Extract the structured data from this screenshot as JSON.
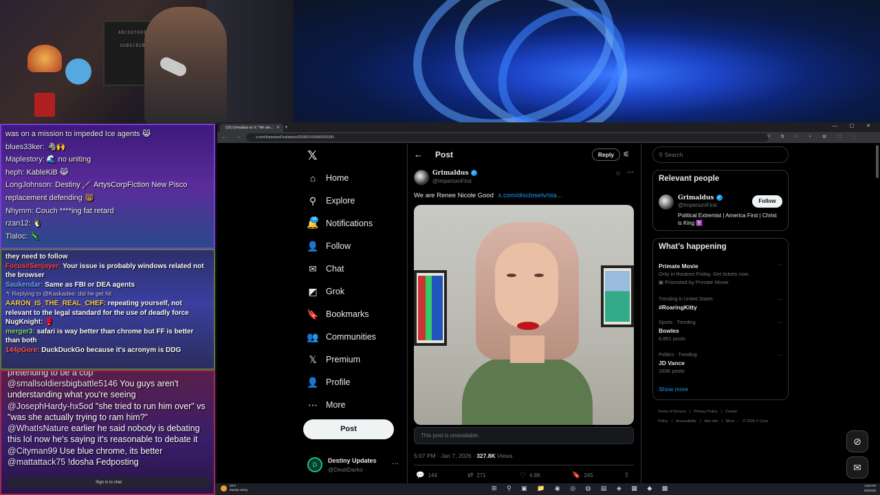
{
  "webcam": {
    "board_lines": [
      "ABCDEFGHIJK",
      "SUBSCRIBER"
    ]
  },
  "chat_panel_1": {
    "messages": [
      {
        "user": "",
        "text": "was on a mission to impeded Ice agents 😹"
      },
      {
        "user": "blues33ker:",
        "text": "🦓🙌"
      },
      {
        "user": "Maplestory:",
        "text": "🌊 no uniting"
      },
      {
        "user": "heph:",
        "text": "KableKiB 😹"
      },
      {
        "user": "LongJohnson:",
        "text": "Destiny 🦯 ArtysCorpFiction New Pisco"
      },
      {
        "user": "",
        "text": "replacement defending 🐻"
      },
      {
        "user": "Nhymm:",
        "text": "Couch ****ing fat retard"
      },
      {
        "user": "rzan12:",
        "text": "🐧"
      },
      {
        "user": "Tlaloc:",
        "text": "🦎"
      }
    ]
  },
  "chat_panel_2": {
    "messages": [
      {
        "user": "",
        "user_color": "#ffffff",
        "text": "they need to follow"
      },
      {
        "user": "Focus#Senjoyer:",
        "user_color": "#ff4444",
        "text": "Your issue is probably windows related not the browser"
      },
      {
        "user": "Saukendar:",
        "user_color": "#6aa8ff",
        "text": "Same as FBI or DEA agents"
      },
      {
        "user": "",
        "user_color": "#c8cbe8",
        "text": "↰ Replying to @Kaskadee: did he get hit",
        "reply": true
      },
      {
        "user": "AARON_IS_THE_REAL_CHEF:",
        "user_color": "#ffd23f",
        "text": "repeating yourself, not relevant to the legal standard for the use of deadly force"
      },
      {
        "user": "NugKnight:",
        "user_color": "#ffffff",
        "text": "🥊"
      },
      {
        "user": "merger3:",
        "user_color": "#7fd96a",
        "text": "safari is way better than chrome but FF is better than both"
      },
      {
        "user": "144pGore:",
        "user_color": "#ff5555",
        "text": "DuckDuckGo because it's acronym is DDG"
      }
    ]
  },
  "chat_panel_3": {
    "clipped_line": "pretending to be a cop",
    "messages": [
      {
        "user": "@smallsoldiersbigbattle5146",
        "text": "You guys aren't understanding what you're seeing"
      },
      {
        "user": "@JosephHardy-hx5od",
        "text": "\"she tried to run him over\" vs \"was she actually trying to ram him?\""
      },
      {
        "user": "@WhatIsNature",
        "text": "earlier he said nobody is debating this lol now he's saying it's reasonable to debate it"
      },
      {
        "user": "@Cityman99",
        "text": "Use blue chrome, its better"
      },
      {
        "user": "@mattattack75",
        "text": "!dosha Fedposting"
      }
    ],
    "signin_label": "Sign in to chat"
  },
  "browser": {
    "tab_title": "(10) Grimaldus on X: \"We are...",
    "url": "x.com/ImperiumFirst/status/2009024193665205281",
    "nav_glyphs": "← → ⟳",
    "window_controls": "— ▢ ✕",
    "extension_glyphs": "⚲ ⧉ ☆ ◐ ▤ ⬚ ⋮"
  },
  "x_nav": {
    "logo": "𝕏",
    "items": [
      {
        "label": "Home",
        "icon": "home-icon",
        "glyph": "⌂"
      },
      {
        "label": "Explore",
        "icon": "search-icon",
        "glyph": "⚲"
      },
      {
        "label": "Notifications",
        "icon": "bell-icon",
        "glyph": "🔔"
      },
      {
        "label": "Follow",
        "icon": "person-add-icon",
        "glyph": "👤"
      },
      {
        "label": "Chat",
        "icon": "mail-icon",
        "glyph": "✉"
      },
      {
        "label": "Grok",
        "icon": "grok-icon",
        "glyph": "◩"
      },
      {
        "label": "Bookmarks",
        "icon": "bookmark-icon",
        "glyph": "🔖"
      },
      {
        "label": "Communities",
        "icon": "people-icon",
        "glyph": "👥"
      },
      {
        "label": "Premium",
        "icon": "x-premium-icon",
        "glyph": "𝕏"
      },
      {
        "label": "Profile",
        "icon": "profile-icon",
        "glyph": "👤"
      },
      {
        "label": "More",
        "icon": "more-circle-icon",
        "glyph": "⋯"
      }
    ],
    "notifications_badge": "16",
    "post_button": "Post",
    "account": {
      "avatar_letter": "D",
      "name": "Destiny Updates",
      "handle": "@DestiDarko",
      "more": "···"
    }
  },
  "post": {
    "header_title": "Post",
    "reply_button": "Reply",
    "author_name": "Grimaldus",
    "author_handle": "@ImperiumFirst",
    "text": "We are Renee Nicole Good",
    "link": "x.com/disclosetv/sta...",
    "unavailable_notice": "This post is unavailable.",
    "time": "5:07 PM · Jan 7, 2026 · ",
    "views_count": "327.8K",
    "views_label": " Views",
    "stats": {
      "replies": "144",
      "reposts": "271",
      "likes": "4.8K",
      "bookmarks": "245"
    }
  },
  "sidebar": {
    "search_placeholder": "Search",
    "relevant": {
      "title": "Relevant people",
      "name": "Grimaldus",
      "handle": "@ImperiumFirst",
      "follow": "Follow",
      "bio": "Political Extremist | America First | Christ is King ✝️"
    },
    "happening": {
      "title": "What’s happening",
      "trends": [
        {
          "meta": "",
          "name": "Primate Movie",
          "sub": "Only in theatres Friday. Get tickets now.",
          "sub2": "Promoted by Primate Movie"
        },
        {
          "meta": "Trending in United States",
          "name": "#RoaringKitty",
          "sub": "",
          "sub2": ""
        },
        {
          "meta": "Sports · Trending",
          "name": "Bowles",
          "sub": "6,851 posts",
          "sub2": ""
        },
        {
          "meta": "Politics · Trending",
          "name": "JD Vance",
          "sub": "160K posts",
          "sub2": ""
        }
      ],
      "show_more": "Show more"
    },
    "footer": [
      "Terms of Service",
      "|",
      "Privacy Policy",
      "|",
      "Cookie Policy",
      "|",
      "Accessibility",
      "|",
      "Ads info",
      "|",
      "More ···",
      "© 2026 X Corp."
    ]
  },
  "taskbar": {
    "weather_temp": "29°F",
    "weather_desc": "Mostly sunny",
    "tray_glyphs": "⊞ ⚲ ▣ 📁 ◉ ◎ ◍ ▤ ◈ ▦ ◆ ▩",
    "clock_time": "2:58 PM",
    "clock_date": "1/8/2026"
  }
}
